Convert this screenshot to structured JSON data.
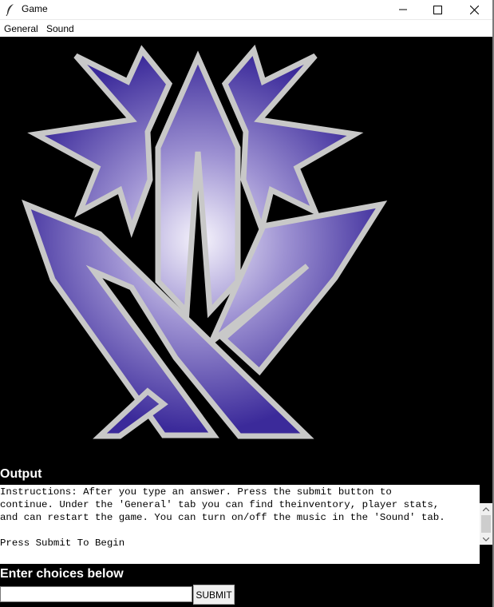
{
  "window": {
    "title": "Game",
    "icon": "feather-icon",
    "controls": [
      "minimize-icon",
      "maximize-icon",
      "close-icon"
    ]
  },
  "menu": {
    "items": [
      "General",
      "Sound"
    ]
  },
  "graphic": {
    "description_icon": "emblem-logo",
    "colors": {
      "fill_dark": "#3b2a9a",
      "fill_light": "#f4f2fb",
      "outline": "#c8c8c8",
      "background": "#000000"
    }
  },
  "output": {
    "label": "Output",
    "lines": [
      "Instructions: After you type an answer. Press the submit button to",
      "continue. Under the 'General' tab you can find theinventory, player stats,",
      "and can restart the game. You can turn on/off the music in the 'Sound' tab.",
      "",
      "Press Submit To Begin"
    ]
  },
  "input": {
    "label": "Enter choices below",
    "value": "",
    "submit_label": "SUBMIT"
  }
}
